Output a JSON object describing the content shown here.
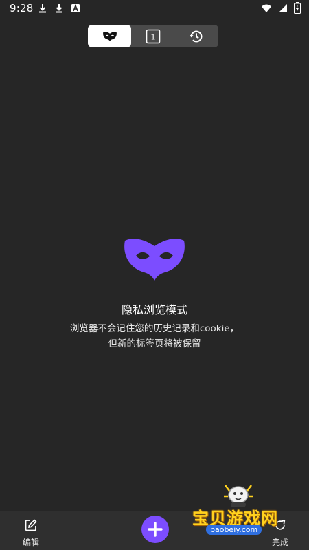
{
  "status_bar": {
    "time": "9:28",
    "left_icons": [
      "download-icon",
      "download-icon",
      "text-icon"
    ],
    "right_icons": [
      "wifi-icon",
      "signal-icon",
      "battery-icon"
    ]
  },
  "mode_switch": {
    "segments": [
      "incognito-mask-icon",
      "tab-count-icon",
      "history-icon"
    ],
    "tab_count": "1",
    "active_index": 0
  },
  "empty_state": {
    "title": "隐私浏览模式",
    "description_line1": "浏览器不会记住您的历史记录和cookie，",
    "description_line2": "但新的标签页将被保留"
  },
  "bottom_bar": {
    "edit_label": "编辑",
    "done_label": "完成"
  },
  "watermark": {
    "title": "宝贝游戏网",
    "url": "baobeiy.com"
  },
  "colors": {
    "background": "#262626",
    "accent": "#7c4dff",
    "switch_bg": "#4a4a4a",
    "bottom_bar_bg": "#2f2f2f"
  }
}
